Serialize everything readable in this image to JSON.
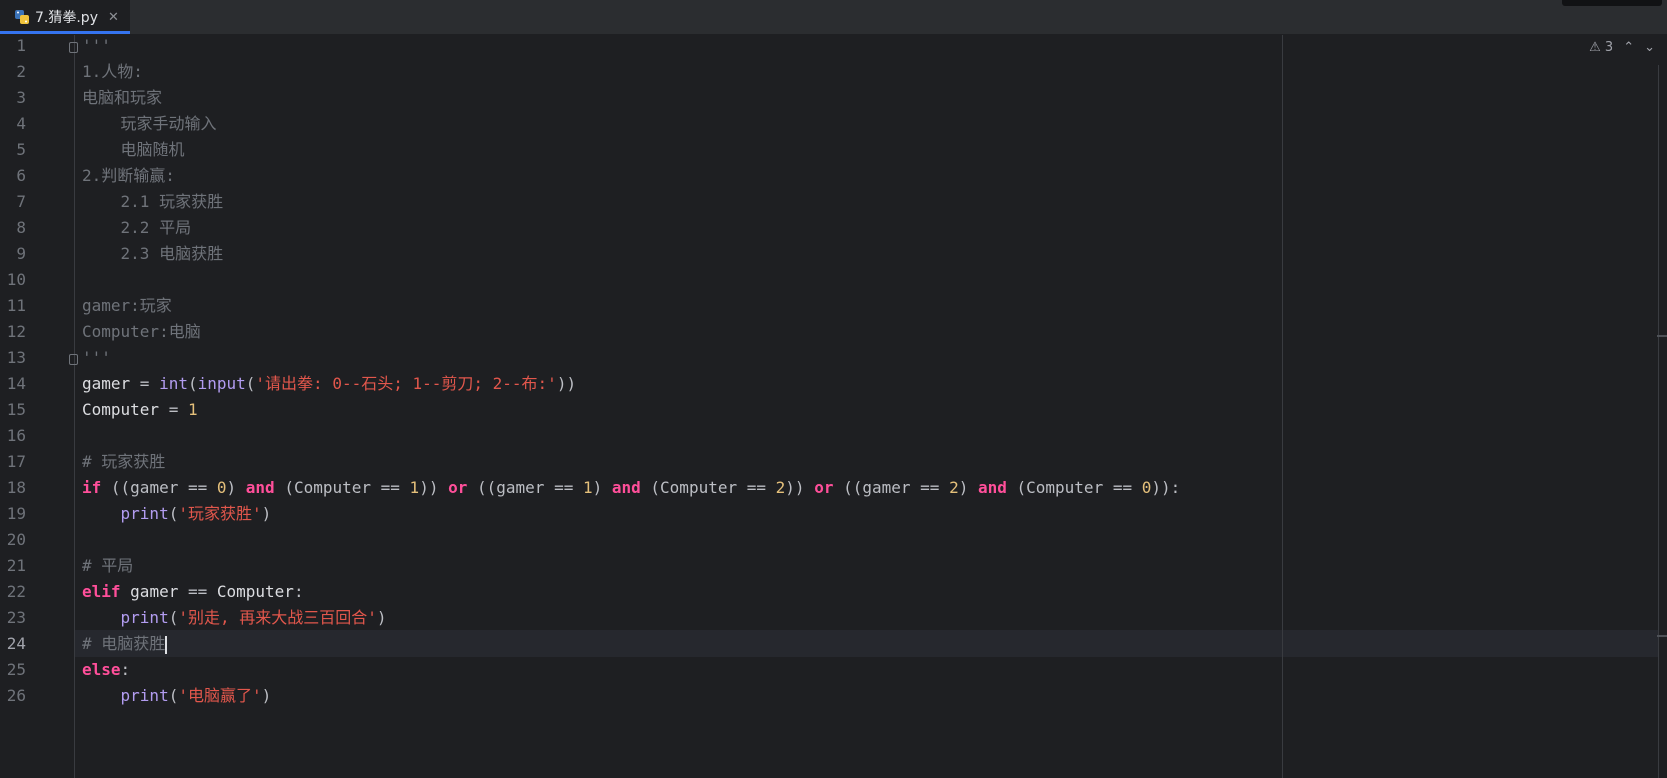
{
  "tab": {
    "filename": "7.猜拳.py",
    "close_glyph": "✕"
  },
  "inspection": {
    "warning_count": "3"
  },
  "lines": [
    {
      "n": "1",
      "segments": [
        {
          "c": "doc",
          "t": "'''"
        }
      ]
    },
    {
      "n": "2",
      "segments": [
        {
          "c": "doc",
          "t": "1.人物:"
        }
      ]
    },
    {
      "n": "3",
      "segments": [
        {
          "c": "doc",
          "t": "电脑和玩家"
        }
      ]
    },
    {
      "n": "4",
      "segments": [
        {
          "c": "doc",
          "t": "    玩家手动输入"
        }
      ]
    },
    {
      "n": "5",
      "segments": [
        {
          "c": "doc",
          "t": "    电脑随机"
        }
      ]
    },
    {
      "n": "6",
      "segments": [
        {
          "c": "doc",
          "t": "2.判断输赢:"
        }
      ]
    },
    {
      "n": "7",
      "segments": [
        {
          "c": "doc",
          "t": "    2.1 玩家获胜"
        }
      ]
    },
    {
      "n": "8",
      "segments": [
        {
          "c": "doc",
          "t": "    2.2 平局"
        }
      ]
    },
    {
      "n": "9",
      "segments": [
        {
          "c": "doc",
          "t": "    2.3 电脑获胜"
        }
      ]
    },
    {
      "n": "10",
      "segments": []
    },
    {
      "n": "11",
      "segments": [
        {
          "c": "doc",
          "t": "gamer:玩家"
        }
      ]
    },
    {
      "n": "12",
      "segments": [
        {
          "c": "doc",
          "t": "Computer:电脑"
        }
      ]
    },
    {
      "n": "13",
      "segments": [
        {
          "c": "doc",
          "t": "'''"
        }
      ]
    },
    {
      "n": "14",
      "segments": [
        {
          "c": "id",
          "t": "gamer "
        },
        {
          "c": "op",
          "t": "= "
        },
        {
          "c": "fn",
          "t": "int"
        },
        {
          "c": "op",
          "t": "("
        },
        {
          "c": "fn",
          "t": "input"
        },
        {
          "c": "op",
          "t": "("
        },
        {
          "c": "str",
          "t": "'请出拳: 0--石头; 1--剪刀; 2--布:'"
        },
        {
          "c": "op",
          "t": "))"
        }
      ]
    },
    {
      "n": "15",
      "segments": [
        {
          "c": "id",
          "t": "Computer "
        },
        {
          "c": "op",
          "t": "= "
        },
        {
          "c": "num",
          "t": "1"
        }
      ]
    },
    {
      "n": "16",
      "segments": []
    },
    {
      "n": "17",
      "segments": [
        {
          "c": "cmt",
          "t": "# 玩家获胜"
        }
      ]
    },
    {
      "n": "18",
      "segments": [
        {
          "c": "kw",
          "t": "if "
        },
        {
          "c": "op",
          "t": "((gamer == "
        },
        {
          "c": "num",
          "t": "0"
        },
        {
          "c": "op",
          "t": ") "
        },
        {
          "c": "kw",
          "t": "and "
        },
        {
          "c": "op",
          "t": "(Computer == "
        },
        {
          "c": "num",
          "t": "1"
        },
        {
          "c": "op",
          "t": ")) "
        },
        {
          "c": "kw",
          "t": "or "
        },
        {
          "c": "op",
          "t": "((gamer == "
        },
        {
          "c": "num",
          "t": "1"
        },
        {
          "c": "op",
          "t": ") "
        },
        {
          "c": "kw",
          "t": "and "
        },
        {
          "c": "op",
          "t": "(Computer == "
        },
        {
          "c": "num",
          "t": "2"
        },
        {
          "c": "op",
          "t": ")) "
        },
        {
          "c": "kw",
          "t": "or "
        },
        {
          "c": "op",
          "t": "((gamer == "
        },
        {
          "c": "num",
          "t": "2"
        },
        {
          "c": "op",
          "t": ") "
        },
        {
          "c": "kw",
          "t": "and "
        },
        {
          "c": "op",
          "t": "(Computer == "
        },
        {
          "c": "num",
          "t": "0"
        },
        {
          "c": "op",
          "t": ")):"
        }
      ]
    },
    {
      "n": "19",
      "segments": [
        {
          "c": "op",
          "t": "    "
        },
        {
          "c": "fn",
          "t": "print"
        },
        {
          "c": "op",
          "t": "("
        },
        {
          "c": "str",
          "t": "'玩家获胜'"
        },
        {
          "c": "op",
          "t": ")"
        }
      ]
    },
    {
      "n": "20",
      "segments": []
    },
    {
      "n": "21",
      "segments": [
        {
          "c": "cmt",
          "t": "# 平局"
        }
      ]
    },
    {
      "n": "22",
      "segments": [
        {
          "c": "kw",
          "t": "elif "
        },
        {
          "c": "id",
          "t": "gamer "
        },
        {
          "c": "op",
          "t": "== "
        },
        {
          "c": "id",
          "t": "Computer"
        },
        {
          "c": "op",
          "t": ":"
        }
      ]
    },
    {
      "n": "23",
      "segments": [
        {
          "c": "op",
          "t": "    "
        },
        {
          "c": "fn",
          "t": "print"
        },
        {
          "c": "op",
          "t": "("
        },
        {
          "c": "str",
          "t": "'别走, 再来大战三百回合'"
        },
        {
          "c": "op",
          "t": ")"
        }
      ]
    },
    {
      "n": "24",
      "segments": [
        {
          "c": "cmt",
          "t": "# 电脑获胜"
        }
      ]
    },
    {
      "n": "25",
      "segments": [
        {
          "c": "kw",
          "t": "else"
        },
        {
          "c": "op",
          "t": ":"
        }
      ]
    },
    {
      "n": "26",
      "segments": [
        {
          "c": "op",
          "t": "    "
        },
        {
          "c": "fn",
          "t": "print"
        },
        {
          "c": "op",
          "t": "("
        },
        {
          "c": "str",
          "t": "'电脑赢了'"
        },
        {
          "c": "op",
          "t": ")"
        }
      ]
    }
  ],
  "current_line": "24",
  "colors": {
    "accent": "#3574f0",
    "keyword": "#ff4f9a",
    "string": "#e2574c",
    "number": "#e5c07b",
    "function": "#b29cf0",
    "comment": "#6f737a"
  }
}
